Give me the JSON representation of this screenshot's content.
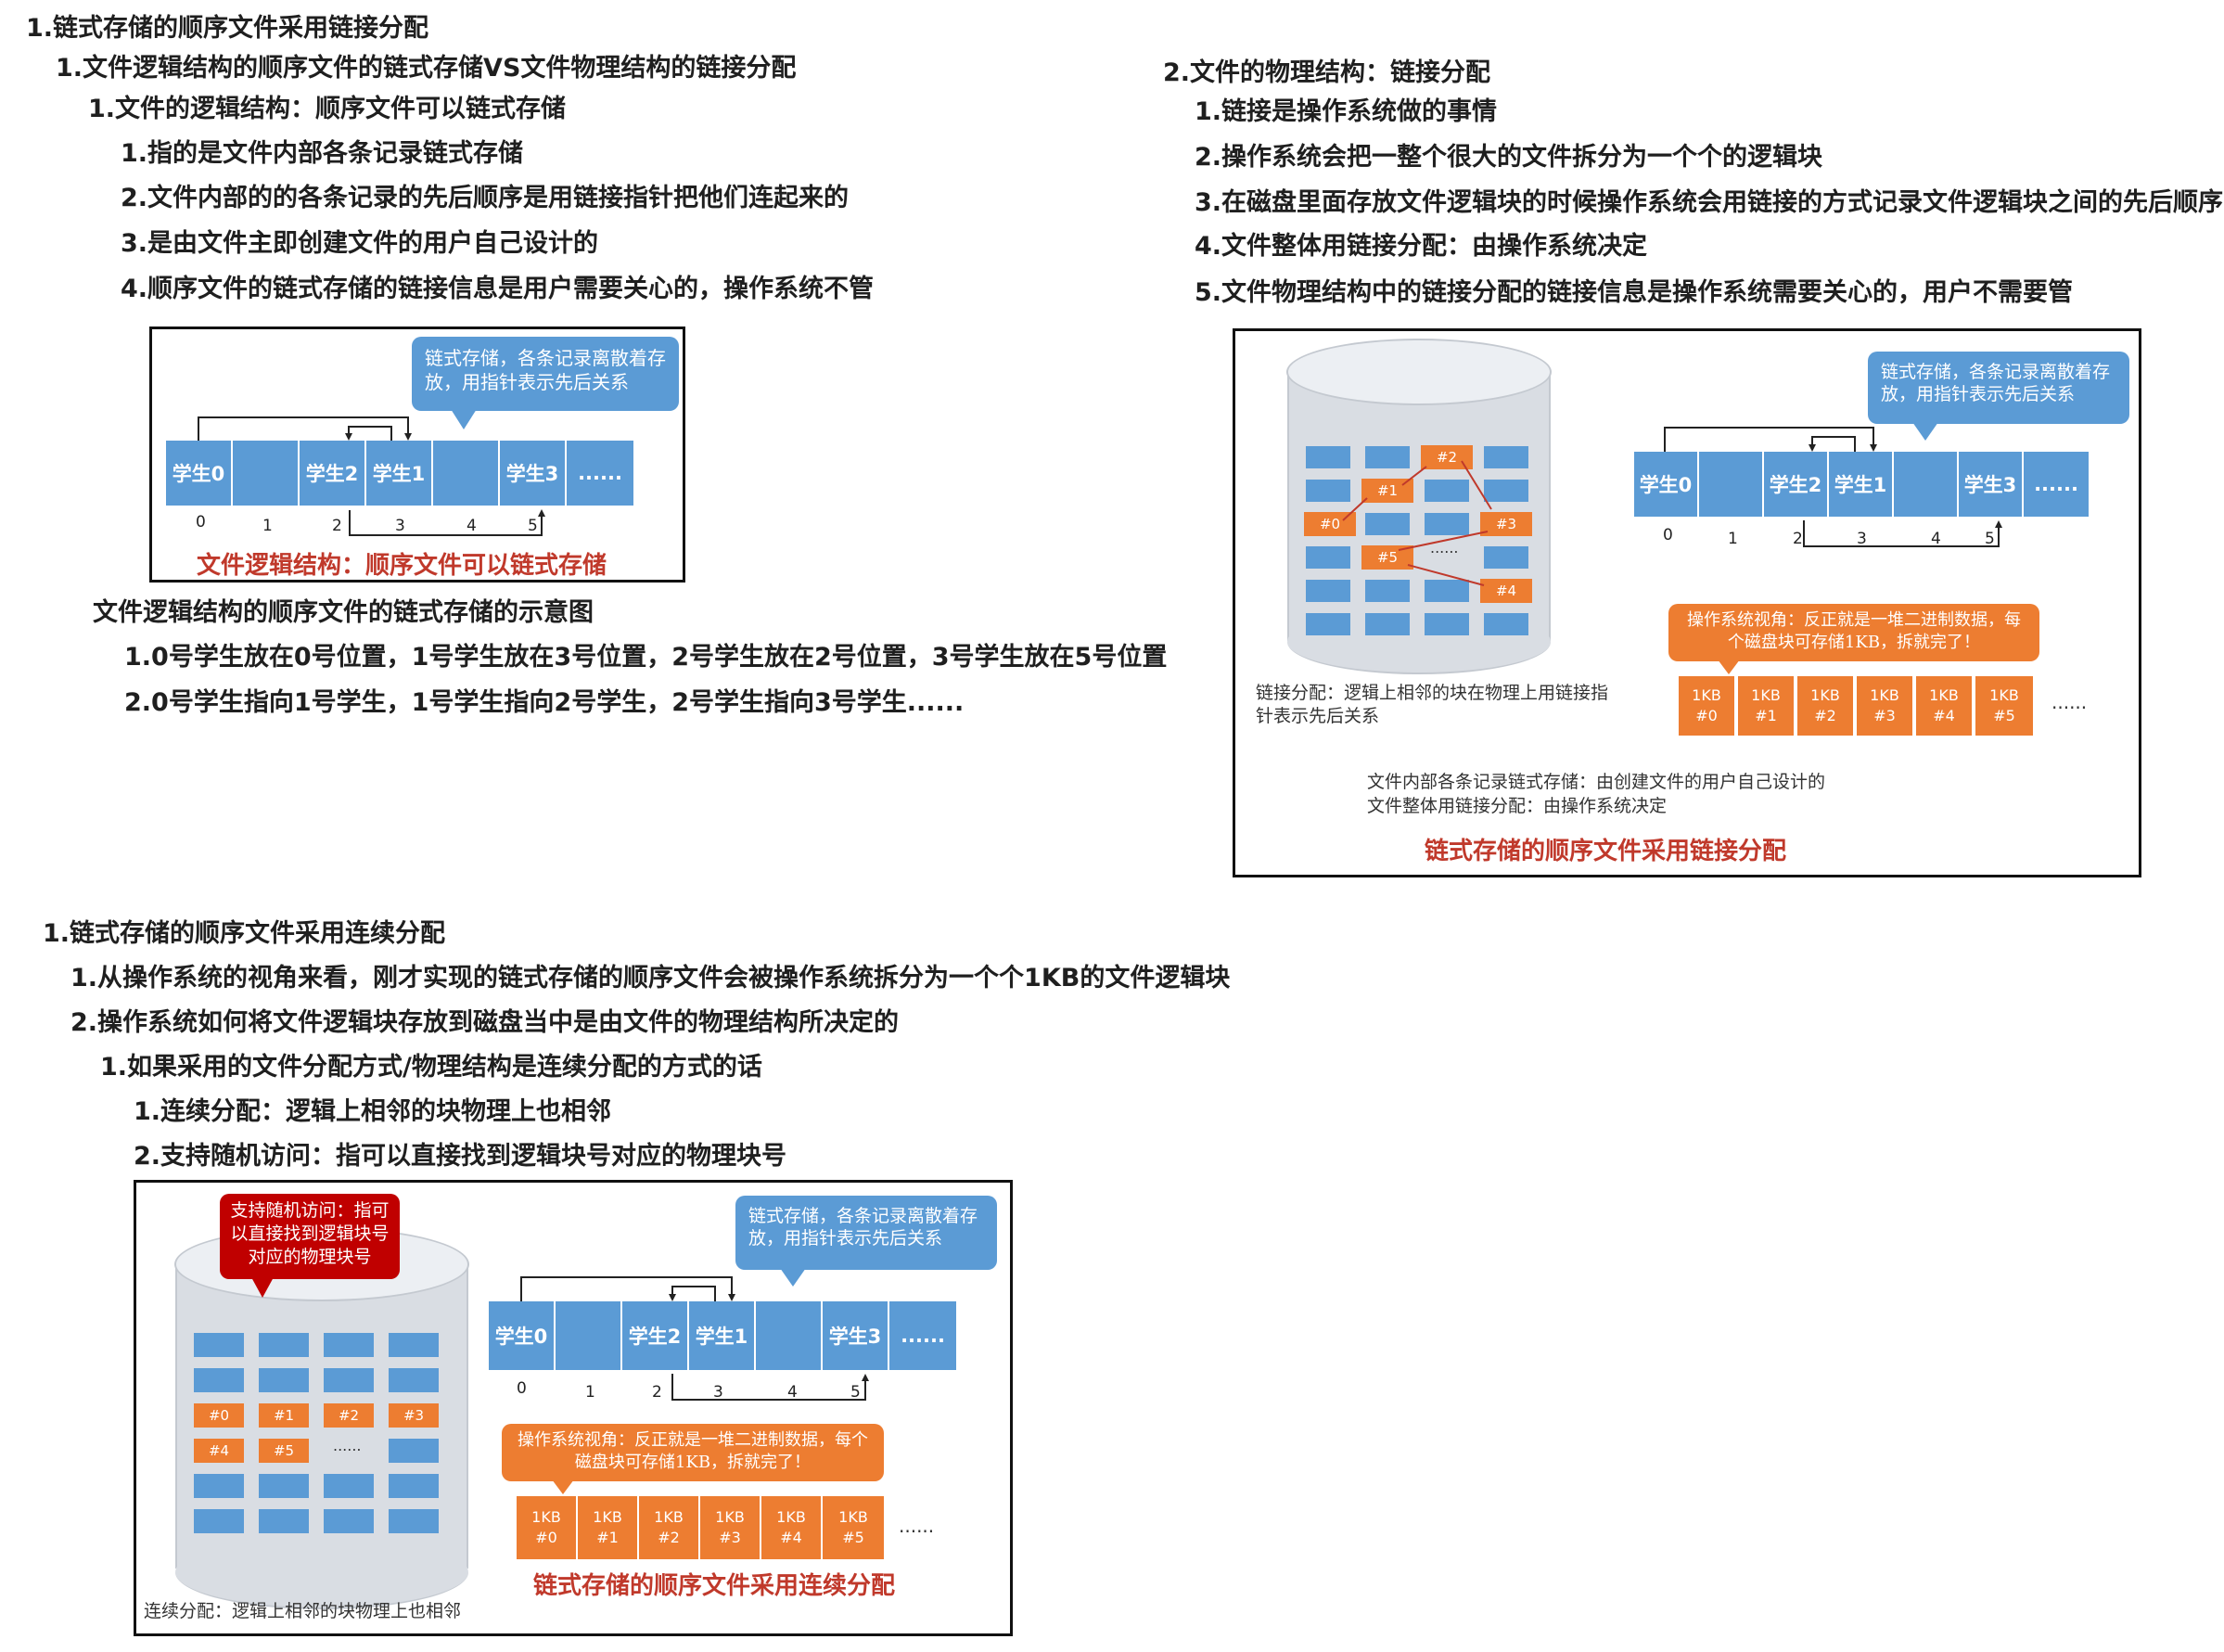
{
  "outline_a": {
    "l1": "1.链式存储的顺序文件采用链接分配",
    "l2": "1.文件逻辑结构的顺序文件的链式存储VS文件物理结构的链接分配",
    "l3": "1.文件的逻辑结构：顺序文件可以链式存储",
    "items": [
      "1.指的是文件内部各条记录链式存储",
      "2.文件内部的的各条记录的先后顺序是用链接指针把他们连起来的",
      "3.是由文件主即创建文件的用户自己设计的",
      "4.顺序文件的链式存储的链接信息是用户需要关心的，操作系统不管"
    ],
    "diagram_title": "文件逻辑结构的顺序文件的链式存储的示意图",
    "diagram_items": [
      "1.0号学生放在0号位置，1号学生放在3号位置，2号学生放在2号位置，3号学生放在5号位置",
      "2.0号学生指向1号学生，1号学生指向2号学生，2号学生指向3号学生......"
    ]
  },
  "outline_b": {
    "title": "2.文件的物理结构：链接分配",
    "items": [
      "1.链接是操作系统做的事情",
      "2.操作系统会把一整个很大的文件拆分为一个个的逻辑块",
      "3.在磁盘里面存放文件逻辑块的时候操作系统会用链接的方式记录文件逻辑块之间的先后顺序",
      "4.文件整体用链接分配：由操作系统决定",
      "5.文件物理结构中的链接分配的链接信息是操作系统需要关心的，用户不需要管"
    ]
  },
  "outline_c": {
    "title": "1.链式存储的顺序文件采用连续分配",
    "items": [
      "1.从操作系统的视角来看，刚才实现的链式存储的顺序文件会被操作系统拆分为一个个1KB的文件逻辑块",
      "2.操作系统如何将文件逻辑块存放到磁盘当中是由文件的物理结构所决定的"
    ],
    "sub": "1.如果采用的文件分配方式/物理结构是连续分配的方式的话",
    "subitems": [
      "1.连续分配：逻辑上相邻的块物理上也相邻",
      "2.支持随机访问：指可以直接找到逻辑块号对应的物理块号"
    ]
  },
  "records": {
    "cells": [
      "学生0",
      "",
      "学生2",
      "学生1",
      "",
      "学生3",
      "......"
    ],
    "indices": [
      "0",
      "1",
      "2",
      "3",
      "4",
      "5"
    ]
  },
  "fig1": {
    "bubble": "链式存储，各条记录离散着存放，用指针表示先后关系",
    "caption": "文件逻辑结构：顺序文件可以链式存储"
  },
  "fig2": {
    "bubble": "链式存储，各条记录离散着存放，用指针表示先后关系",
    "os_bubble": "操作系统视角：反正就是一堆二进制数据，每个磁盘块可存储1KB，拆就完了！",
    "disk_note": "链接分配：逻辑上相邻的块在物理上用链接指针表示先后关系",
    "note_lines": [
      "文件内部各条记录链式存储：由创建文件的用户自己设计的",
      "文件整体用链接分配：由操作系统决定"
    ],
    "caption": "链式存储的顺序文件采用链接分配",
    "disk_blocks": [
      "#0",
      "#1",
      "#2",
      "#3",
      "#4",
      "#5"
    ],
    "disk_dots": "......"
  },
  "fig3": {
    "red_bubble": "支持随机访问：指可以直接找到逻辑块号对应的物理块号",
    "bubble": "链式存储，各条记录离散着存放，用指针表示先后关系",
    "os_bubble": "操作系统视角：反正就是一堆二进制数据，每个磁盘块可存储1KB，拆就完了！",
    "disk_note": "连续分配：逻辑上相邻的块物理上也相邻",
    "caption": "链式存储的顺序文件采用连续分配",
    "disk_blocks": [
      "#0",
      "#1",
      "#2",
      "#3",
      "#4",
      "#5"
    ],
    "disk_dots": "......"
  },
  "kb_blocks": [
    {
      "size": "1KB",
      "id": "#0"
    },
    {
      "size": "1KB",
      "id": "#1"
    },
    {
      "size": "1KB",
      "id": "#2"
    },
    {
      "size": "1KB",
      "id": "#3"
    },
    {
      "size": "1KB",
      "id": "#4"
    },
    {
      "size": "1KB",
      "id": "#5"
    }
  ],
  "kb_dots": "......",
  "colors": {
    "blue": "#5b9bd5",
    "orange": "#ed7d31",
    "red": "#c00000",
    "caption": "#c0392b"
  }
}
